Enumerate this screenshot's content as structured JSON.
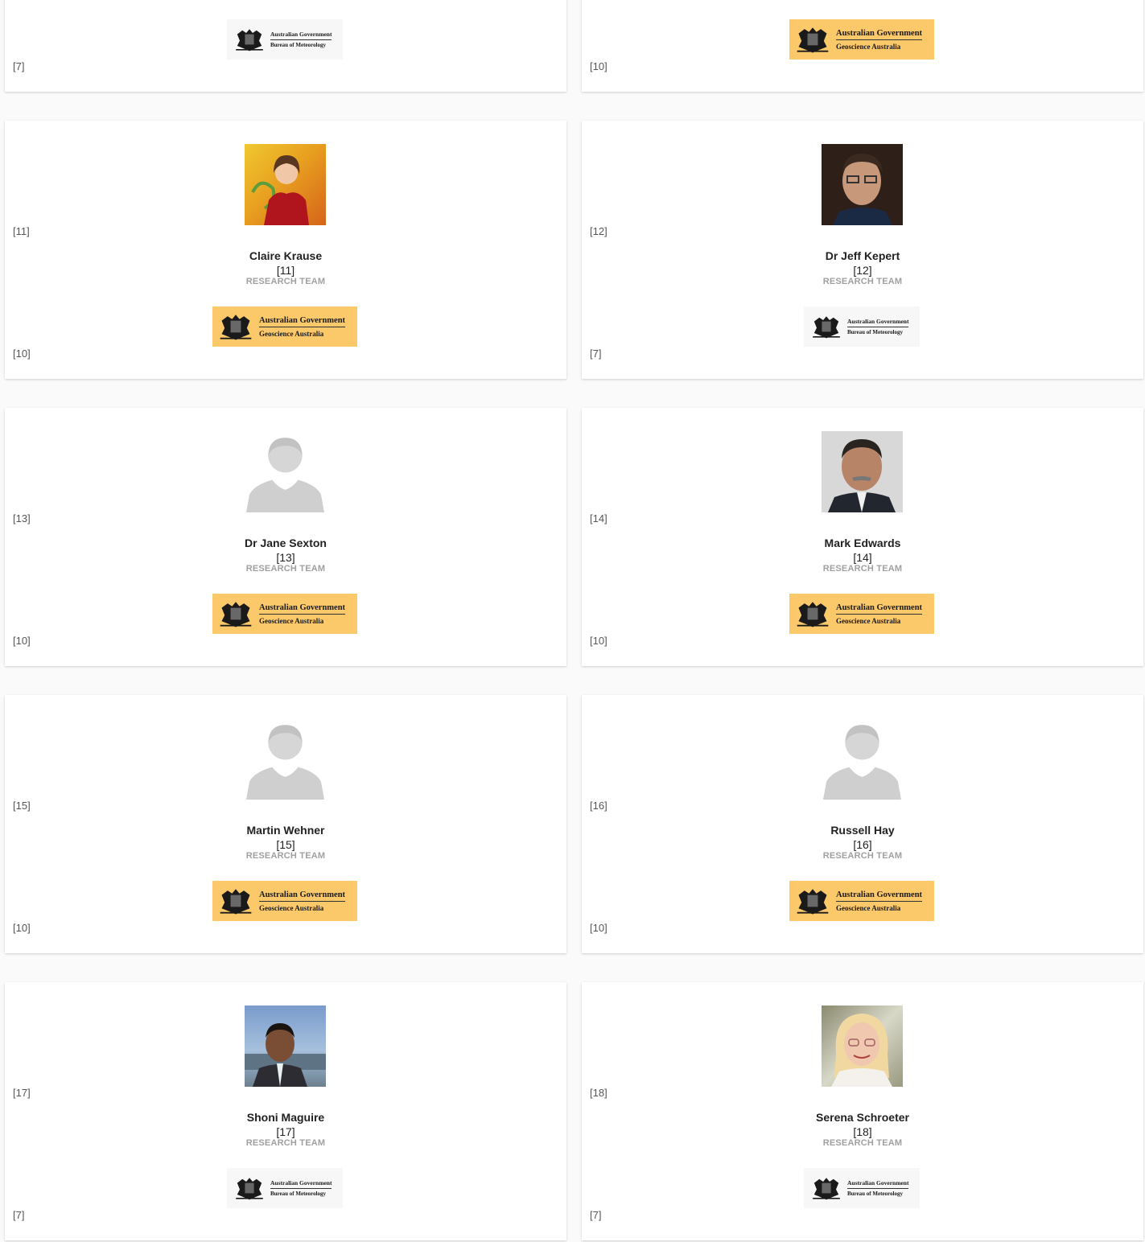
{
  "colors": {
    "ga_logo_bg": "#fcc96a",
    "team_label": "#a0a0a0",
    "card_bg": "#ffffff"
  },
  "logos": {
    "ga": {
      "line1": "Australian Government",
      "line2": "Geoscience Australia"
    },
    "bom": {
      "line1": "Australian Government",
      "line2": "Bureau of Meteorology"
    }
  },
  "top_cards": [
    {
      "org_ref": "[7]"
    },
    {
      "org_ref": "[10]"
    }
  ],
  "members": [
    {
      "name": "Claire Krause",
      "ref": "[11]",
      "team": "RESEARCH TEAM",
      "org_ref": "[10]"
    },
    {
      "name": "Dr Jeff Kepert",
      "ref": "[12]",
      "team": "RESEARCH TEAM",
      "org_ref": "[7]"
    },
    {
      "name": "Dr Jane Sexton",
      "ref": "[13]",
      "team": "RESEARCH TEAM",
      "org_ref": "[10]"
    },
    {
      "name": "Mark Edwards",
      "ref": "[14]",
      "team": "RESEARCH TEAM",
      "org_ref": "[10]"
    },
    {
      "name": "Martin Wehner",
      "ref": "[15]",
      "team": "RESEARCH TEAM",
      "org_ref": "[10]"
    },
    {
      "name": "Russell Hay",
      "ref": "[16]",
      "team": "RESEARCH TEAM",
      "org_ref": "[10]"
    },
    {
      "name": "Shoni Maguire",
      "ref": "[17]",
      "team": "RESEARCH TEAM",
      "org_ref": "[7]"
    },
    {
      "name": "Serena Schroeter",
      "ref": "[18]",
      "team": "RESEARCH TEAM",
      "org_ref": "[7]"
    }
  ]
}
